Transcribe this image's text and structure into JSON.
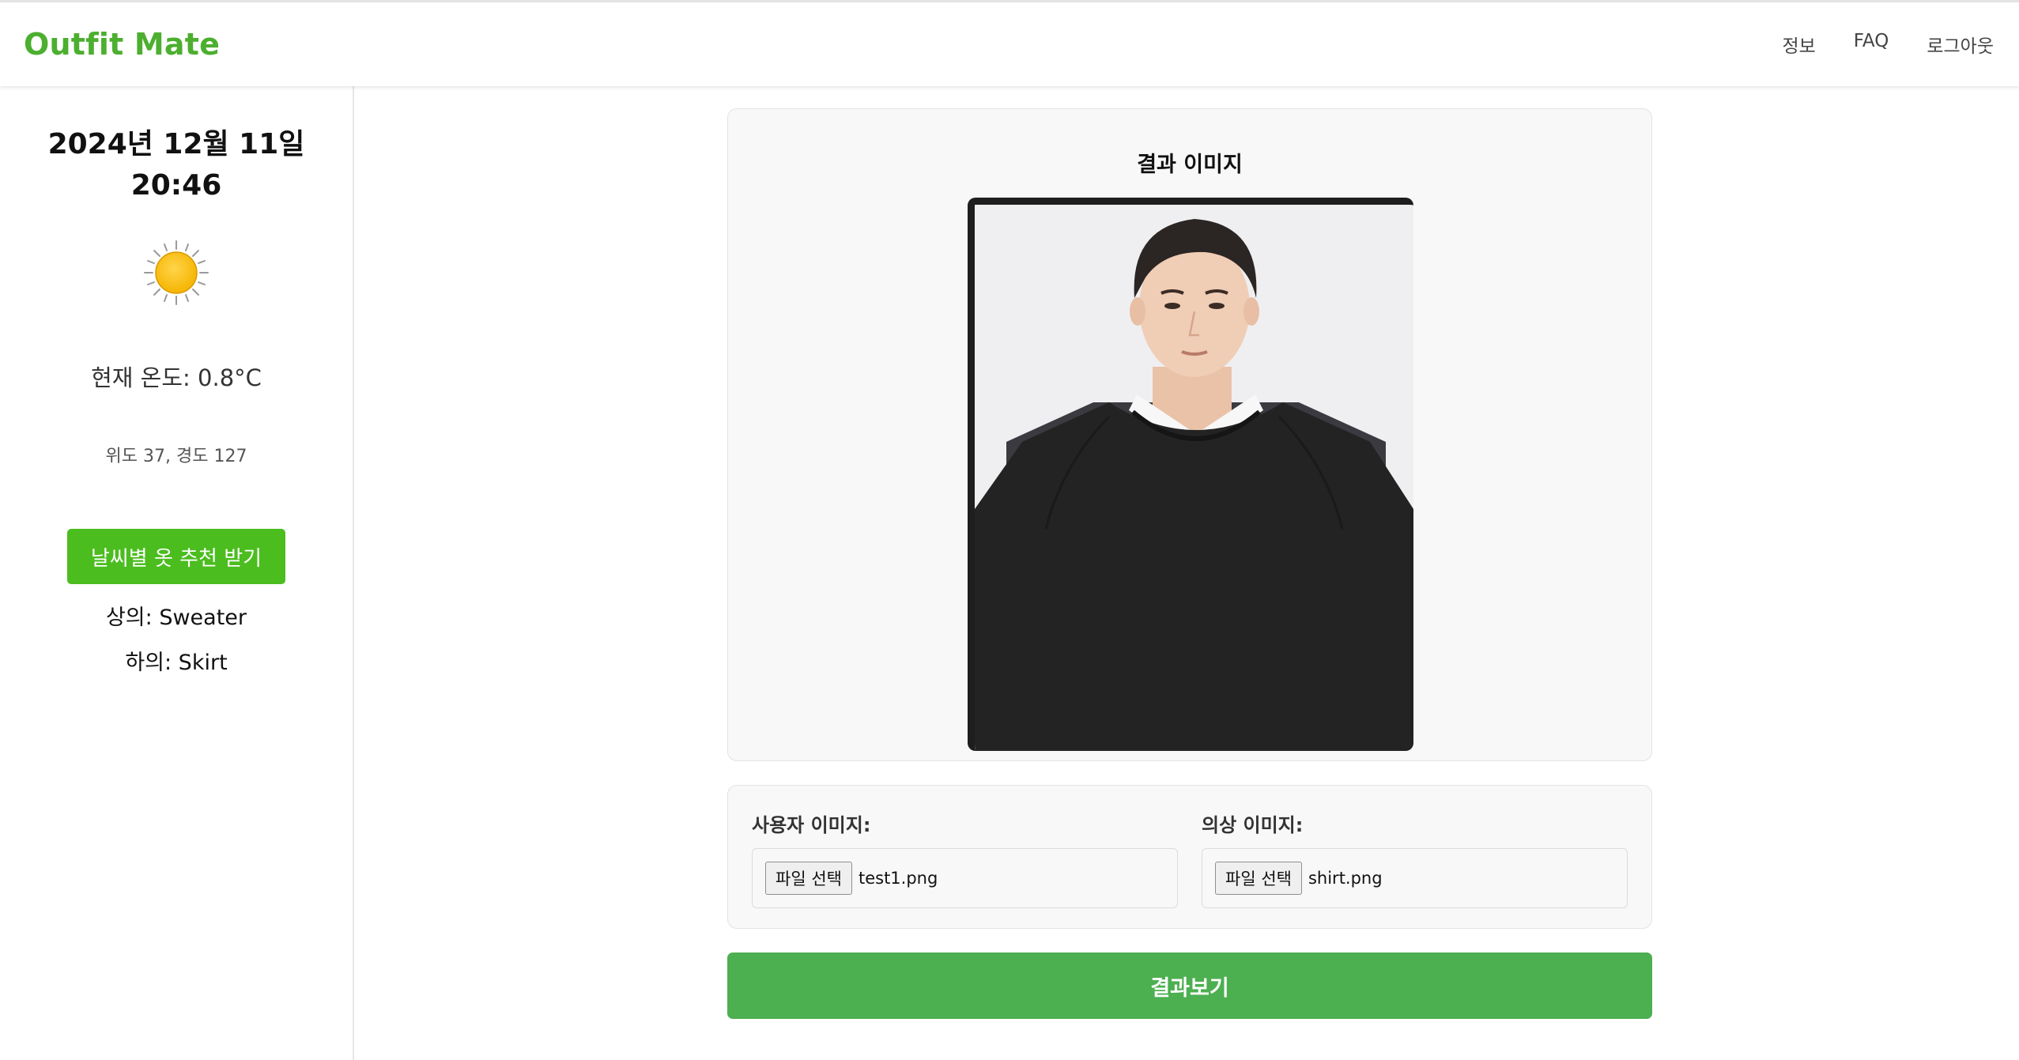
{
  "navbar": {
    "brand": "Outfit Mate",
    "links": [
      "정보",
      "FAQ",
      "로그아웃"
    ]
  },
  "sidebar": {
    "date": "2024년 12월 11일",
    "time": "20:46",
    "weather_icon": "sun-icon",
    "temperature": "현재 온도: 0.8°C",
    "coordinates": "위도 37, 경도 127",
    "recommend_button": "날씨별 옷 추천 받기",
    "top_recommendation": "상의: Sweater",
    "bottom_recommendation": "하의: Skirt"
  },
  "result": {
    "title": "결과 이미지"
  },
  "upload": {
    "user_label": "사용자 이미지:",
    "user_file_button": "파일 선택",
    "user_file_name": "test1.png",
    "clothing_label": "의상 이미지:",
    "clothing_file_button": "파일 선택",
    "clothing_file_name": "shirt.png"
  },
  "submit_button": "결과보기",
  "colors": {
    "brand": "#4caf2f",
    "recommend_button": "#4bbd1f",
    "submit_button": "#4caf50"
  }
}
